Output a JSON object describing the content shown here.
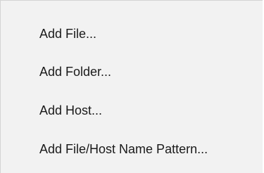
{
  "context_menu": {
    "items": [
      {
        "label": "Add File..."
      },
      {
        "label": "Add Folder..."
      },
      {
        "label": "Add Host..."
      },
      {
        "label": "Add File/Host Name Pattern..."
      }
    ]
  },
  "colors": {
    "menu_background": "#f2f2f2",
    "border": "#d4d4d4",
    "text": "#1a1a1a"
  }
}
